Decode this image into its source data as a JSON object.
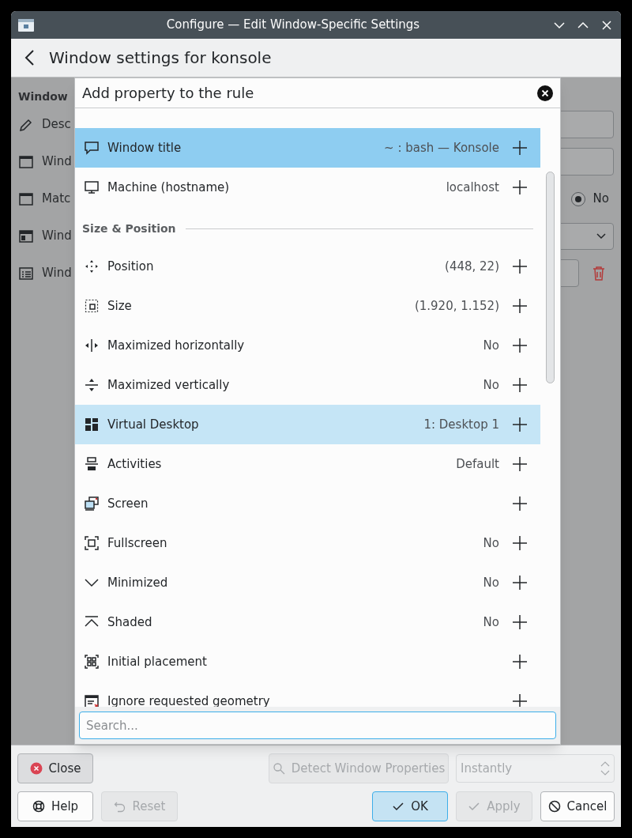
{
  "window": {
    "title": "Configure — Edit Window-Specific Settings"
  },
  "header": {
    "title": "Window settings for konsole"
  },
  "background": {
    "heading": "Window",
    "rows": [
      {
        "label": "Desc",
        "kind": "field"
      },
      {
        "label": "Wind",
        "kind": "field"
      },
      {
        "label": "Matc",
        "kind": "radio",
        "option": "No",
        "checked": true
      },
      {
        "label": "Wind",
        "kind": "combo"
      },
      {
        "label": "Wind",
        "kind": "delete"
      }
    ]
  },
  "dialog": {
    "title": "Add property to the rule",
    "items": [
      {
        "kind": "property",
        "label": "Window title",
        "value": "~ : bash — Konsole",
        "added": false,
        "selected": true,
        "hovered": false
      },
      {
        "kind": "property",
        "label": "Machine (hostname)",
        "value": "localhost",
        "added": false,
        "selected": false,
        "hovered": false
      },
      {
        "kind": "section",
        "label": "Size & Position"
      },
      {
        "kind": "property",
        "label": "Position",
        "value": "(448, 22)",
        "added": false,
        "selected": false,
        "hovered": false
      },
      {
        "kind": "property",
        "label": "Size",
        "value": "(1.920, 1.152)",
        "added": false,
        "selected": false,
        "hovered": false
      },
      {
        "kind": "property",
        "label": "Maximized horizontally",
        "value": "No",
        "added": false,
        "selected": false,
        "hovered": false
      },
      {
        "kind": "property",
        "label": "Maximized vertically",
        "value": "No",
        "added": false,
        "selected": false,
        "hovered": false
      },
      {
        "kind": "property",
        "label": "Virtual Desktop",
        "value": "1: Desktop 1",
        "added": false,
        "selected": false,
        "hovered": true
      },
      {
        "kind": "property",
        "label": "Activities",
        "value": "Default",
        "added": false,
        "selected": false,
        "hovered": false
      },
      {
        "kind": "property",
        "label": "Screen",
        "added": false,
        "selected": false,
        "hovered": false
      },
      {
        "kind": "property",
        "label": "Fullscreen",
        "value": "No",
        "added": false,
        "selected": false,
        "hovered": false
      },
      {
        "kind": "property",
        "label": "Minimized",
        "value": "No",
        "added": false,
        "selected": false,
        "hovered": false
      },
      {
        "kind": "property",
        "label": "Shaded",
        "value": "No",
        "added": false,
        "selected": false,
        "hovered": false
      },
      {
        "kind": "property",
        "label": "Initial placement",
        "added": false,
        "selected": false,
        "hovered": false
      },
      {
        "kind": "property",
        "label": "Ignore requested geometry",
        "added": false,
        "selected": false,
        "hovered": false
      }
    ],
    "search": {
      "placeholder": "Search..."
    }
  },
  "footer": {
    "row1": [
      {
        "kind": "close",
        "label": "Close",
        "disabled": false
      },
      {
        "kind": "detect",
        "label": "Detect Window Properties",
        "disabled": true
      },
      {
        "kind": "spin",
        "label": "Instantly",
        "disabled": true
      }
    ],
    "row2": [
      {
        "kind": "help",
        "label": "Help",
        "disabled": false,
        "default": false
      },
      {
        "kind": "reset",
        "label": "Reset",
        "disabled": true,
        "default": false
      },
      {
        "kind": "ok",
        "label": "OK",
        "disabled": false,
        "default": true
      },
      {
        "kind": "apply",
        "label": "Apply",
        "disabled": true,
        "default": false
      },
      {
        "kind": "cancel",
        "label": "Cancel",
        "disabled": false,
        "default": false
      }
    ]
  }
}
